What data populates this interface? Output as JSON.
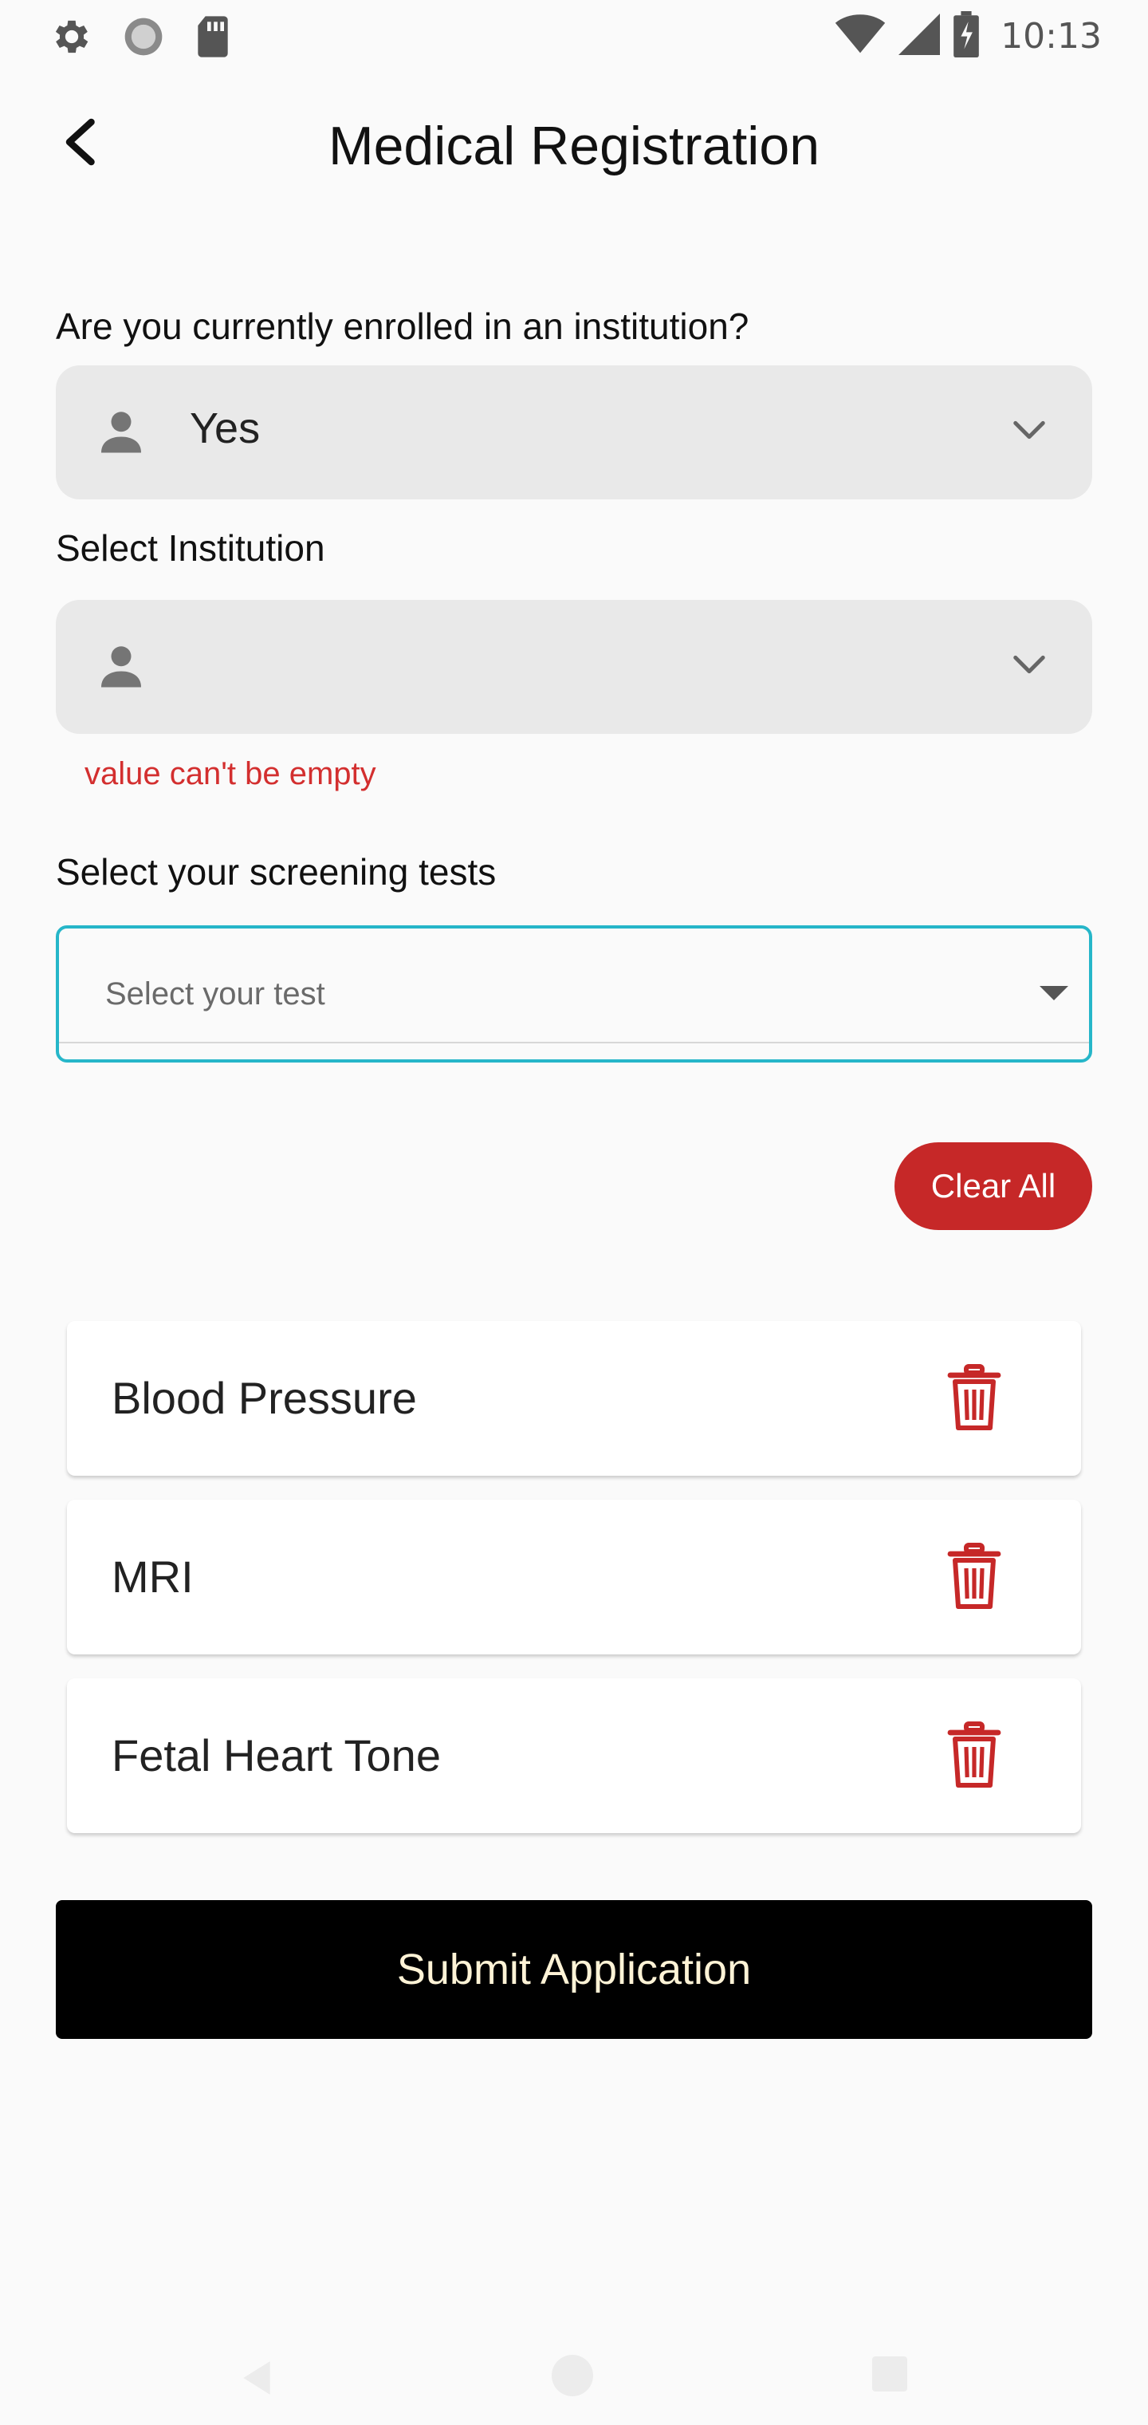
{
  "status_bar": {
    "time": "10:13",
    "icons": [
      "settings-icon",
      "sync-icon",
      "sd-card-icon",
      "wifi-icon",
      "signal-icon",
      "battery-icon"
    ]
  },
  "header": {
    "title": "Medical Registration",
    "back_icon": "back-arrow-icon"
  },
  "form": {
    "enrolled": {
      "label": "Are you currently enrolled in an institution?",
      "value": "Yes",
      "icon": "person-icon"
    },
    "institution": {
      "label": "Select Institution",
      "value": "",
      "error": "value can't be empty",
      "icon": "person-icon"
    },
    "tests": {
      "label": "Select your screening tests",
      "placeholder": "Select your test",
      "accent_color": "#26b6c9"
    }
  },
  "clear_all_label": "Clear All",
  "selected_tests": [
    {
      "name": "Blood Pressure"
    },
    {
      "name": "MRI"
    },
    {
      "name": "Fetal Heart Tone"
    }
  ],
  "submit_label": "Submit Application",
  "colors": {
    "danger": "#c62828",
    "primary_button": "#000000",
    "submit_text": "#fff3d6",
    "error_text": "#d32f2f"
  }
}
